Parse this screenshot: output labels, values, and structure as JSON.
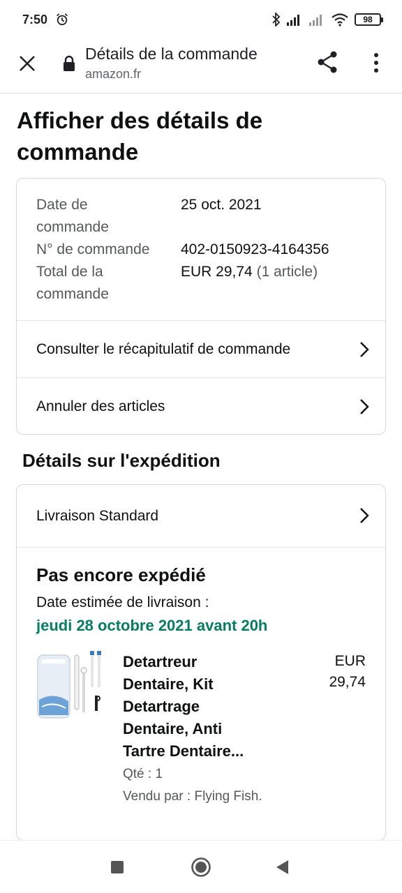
{
  "status_bar": {
    "time": "7:50",
    "battery": "98"
  },
  "browser": {
    "title": "Détails de la commande",
    "url": "amazon.fr"
  },
  "page_title": "Afficher des détails de commande",
  "order": {
    "date_label": "Date de commande",
    "date_value": "25 oct. 2021",
    "number_label": "N° de commande",
    "number_value": "402-0150923-4164356",
    "total_label": "Total de la commande",
    "total_value": "EUR 29,74",
    "total_count": "(1 article)"
  },
  "links": {
    "summary": "Consulter le récapitulatif de commande",
    "cancel": "Annuler des articles"
  },
  "shipping": {
    "section_title": "Détails sur l'expédition",
    "method": "Livraison Standard",
    "status": "Pas encore expédié",
    "estimate_label": "Date estimée de livraison :",
    "estimate_date": "jeudi 28 octobre 2021 avant 20h"
  },
  "product": {
    "name_lines": [
      "Detartreur",
      "Dentaire, Kit",
      "Detartrage",
      "Dentaire, Anti",
      "Tartre Dentaire..."
    ],
    "price_currency": "EUR",
    "price_amount": "29,74",
    "quantity": "Qté : 1",
    "seller": "Vendu par : Flying Fish."
  },
  "colors": {
    "delivery_green": "#067d62",
    "text": "#0f1111",
    "muted": "#565959"
  }
}
